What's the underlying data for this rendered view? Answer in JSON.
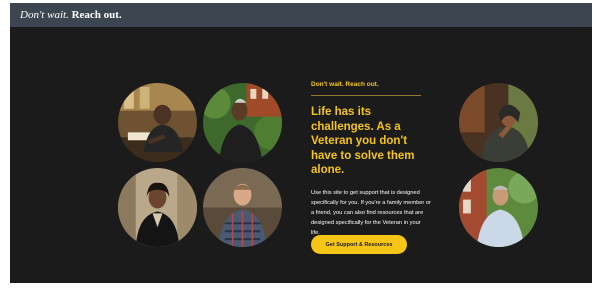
{
  "header": {
    "brand_italic": "Don't wait.",
    "brand_bold": "Reach out."
  },
  "hero": {
    "eyebrow": "Don't wait. Reach out.",
    "headline": "Life has its challenges. As a Veteran you don't have to solve them alone.",
    "body": "Use this site to get support that is designed specifically for you. If you're a family member or a friend, you can also find resources that are designed specifically for the Veteran in your life.",
    "cta_label": "Get Support & Resources"
  },
  "photos": [
    {
      "name": "veteran-photo-1",
      "icon": "man-at-table"
    },
    {
      "name": "veteran-photo-2",
      "icon": "man-outdoors-greenery"
    },
    {
      "name": "veteran-photo-3",
      "icon": "woman-portrait"
    },
    {
      "name": "veteran-photo-4",
      "icon": "man-plaid-shirt"
    },
    {
      "name": "veteran-photo-5",
      "icon": "man-hooded-thinking"
    },
    {
      "name": "veteran-photo-6",
      "icon": "man-white-shirt-outdoors"
    }
  ],
  "colors": {
    "accent": "#f5c518",
    "background": "#1b1b1c",
    "topbar": "#3c4650"
  }
}
